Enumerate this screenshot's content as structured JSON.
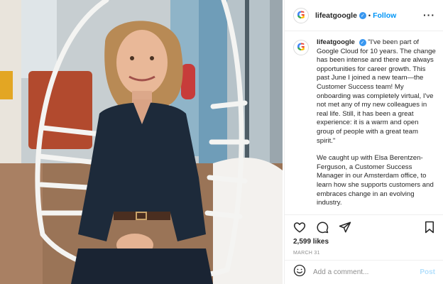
{
  "post": {
    "account": "lifeatgoogle",
    "follow_label": "Follow",
    "dot": "•",
    "more_label": "···",
    "caption_paragraphs": [
      "\"I've been part of Google Cloud for 10 years. The change has been intense and there are always opportunities for career growth. This past June I joined a new team—the Customer Success team! My onboarding was completely virtual, I've not met any of my new colleagues in real life. Still, it has been a great experience: it is a warm and open group of people with a great team spirit.\"",
      "We caught up with Elsa Berentzen-Ferguson, a Customer Success Manager in our Amsterdam office, to learn how she supports customers and embraces change in an evolving industry."
    ],
    "likes": "2,599 likes",
    "date": "MARCH 31",
    "comment_placeholder": "Add a comment...",
    "post_button": "Post"
  },
  "icons": {
    "avatar": "google-g-logo",
    "verified": "verified-badge-icon",
    "like": "heart-icon",
    "comment": "comment-bubble-icon",
    "share": "paper-plane-icon",
    "save": "bookmark-icon",
    "emoji": "smiley-icon"
  },
  "colors": {
    "link_blue": "#0095f6",
    "post_button_disabled": "#b2dffc",
    "verified_blue": "#3897f0",
    "muted_text": "#8e8e8e"
  }
}
